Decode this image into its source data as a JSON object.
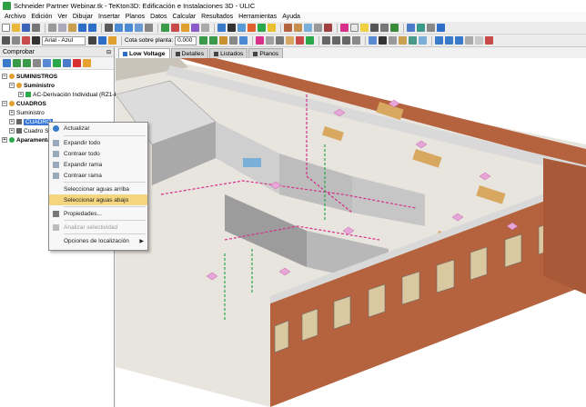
{
  "window": {
    "title": "Schneider Partner Webinar.tk - TeKton3D: Edificación e Instalaciones 3D - ULIC"
  },
  "menu": [
    "Archivo",
    "Edición",
    "Ver",
    "Dibujar",
    "Insertar",
    "Planos",
    "Datos",
    "Calcular",
    "Resultados",
    "Herramientas",
    "Ayuda"
  ],
  "toolbar": {
    "font_name": "Arial - Azul",
    "cota_label": "Cota sobre planta:",
    "cota_value": "0.000"
  },
  "panel": {
    "title": "Comprobar",
    "tree": [
      {
        "label": "SUMINISTROS",
        "level": 0,
        "bold": true
      },
      {
        "label": "Suministro",
        "level": 1,
        "bold": true
      },
      {
        "label": "AC-Derivación Individual (RZ1-K",
        "level": 2,
        "bold": false
      },
      {
        "label": "CUADROS",
        "level": 0,
        "bold": true
      },
      {
        "label": "Suministro",
        "level": 1,
        "bold": false
      },
      {
        "label": "CUADRO",
        "level": 1,
        "bold": false,
        "selected": true
      },
      {
        "label": "Cuadro Se",
        "level": 1,
        "bold": false
      },
      {
        "label": "Aparamenta",
        "level": 0,
        "bold": true
      }
    ]
  },
  "tabs": [
    {
      "label": "Low Voltage",
      "active": true
    },
    {
      "label": "Detalles",
      "active": false
    },
    {
      "label": "Listados",
      "active": false
    },
    {
      "label": "Planos",
      "active": false
    }
  ],
  "context_menu": {
    "items": [
      {
        "label": "Actualizar",
        "icon": "refresh-icon",
        "disabled": false
      },
      {
        "sep": true
      },
      {
        "label": "Expandir todo",
        "icon": "expand-icon",
        "disabled": false
      },
      {
        "label": "Contraer todo",
        "icon": "collapse-icon",
        "disabled": false
      },
      {
        "label": "Expandir rama",
        "icon": "expand-branch-icon",
        "disabled": false
      },
      {
        "label": "Contraer rama",
        "icon": "collapse-branch-icon",
        "disabled": false
      },
      {
        "sep": true
      },
      {
        "label": "Seleccionar aguas arriba",
        "disabled": false
      },
      {
        "label": "Seleccionar aguas abajo",
        "disabled": false,
        "highlight": true
      },
      {
        "sep": true
      },
      {
        "label": "Propiedades...",
        "icon": "properties-icon",
        "disabled": false
      },
      {
        "sep": true
      },
      {
        "label": "Analizar selectividad",
        "icon": "analyze-icon",
        "disabled": true
      },
      {
        "sep": true
      },
      {
        "label": "Opciones de localización",
        "disabled": false,
        "submenu": true
      }
    ]
  },
  "colors": {
    "brick": "#b5633f",
    "floor": "#e8e4de",
    "wall_top": "#d9d9d9",
    "cable": "#d6308a",
    "selection": "#3a78d8",
    "highlight": "#f5d680"
  }
}
